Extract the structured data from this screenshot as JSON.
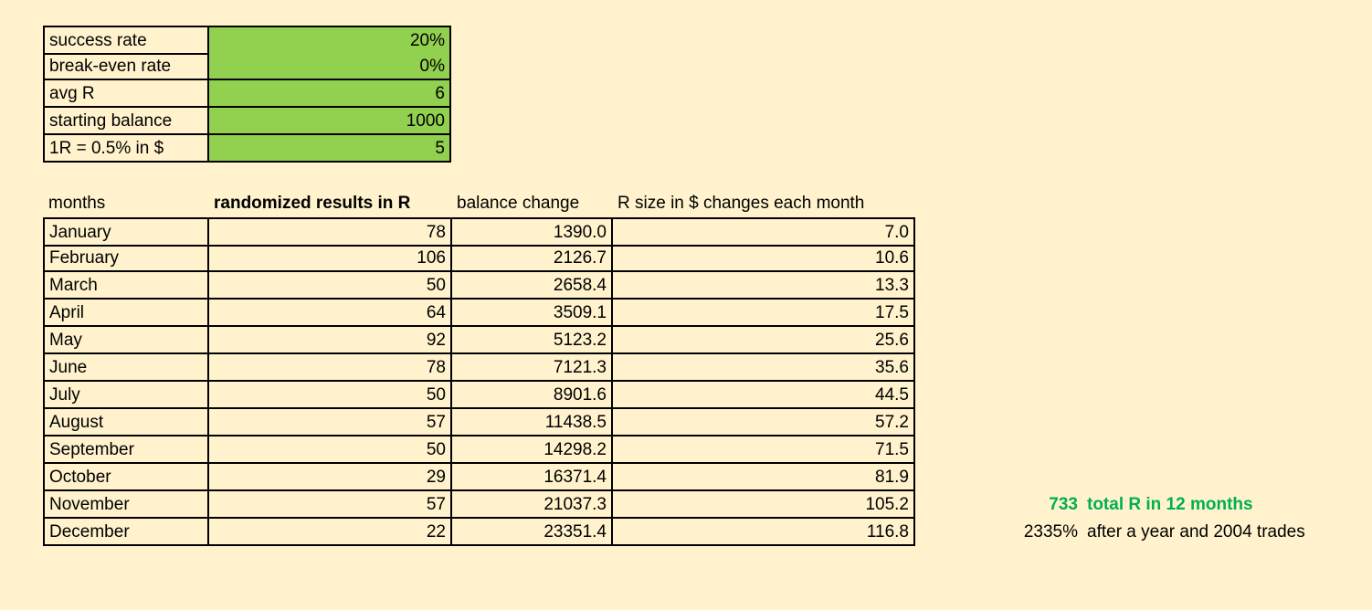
{
  "params": [
    {
      "label": "success rate",
      "value": "20%"
    },
    {
      "label": "break-even rate",
      "value": "0%"
    },
    {
      "label": "avg R",
      "value": "6"
    },
    {
      "label": "starting balance",
      "value": "1000"
    },
    {
      "label": "1R = 0.5% in $",
      "value": "5"
    }
  ],
  "table": {
    "headers": [
      "months",
      "randomized results in R",
      "balance change",
      "R size in $ changes each month"
    ],
    "rows": [
      {
        "month": "January",
        "r": "78",
        "balance": "1390.0",
        "rsize": "7.0"
      },
      {
        "month": "February",
        "r": "106",
        "balance": "2126.7",
        "rsize": "10.6"
      },
      {
        "month": "March",
        "r": "50",
        "balance": "2658.4",
        "rsize": "13.3"
      },
      {
        "month": "April",
        "r": "64",
        "balance": "3509.1",
        "rsize": "17.5"
      },
      {
        "month": "May",
        "r": "92",
        "balance": "5123.2",
        "rsize": "25.6"
      },
      {
        "month": "June",
        "r": "78",
        "balance": "7121.3",
        "rsize": "35.6"
      },
      {
        "month": "July",
        "r": "50",
        "balance": "8901.6",
        "rsize": "44.5"
      },
      {
        "month": "August",
        "r": "57",
        "balance": "11438.5",
        "rsize": "57.2"
      },
      {
        "month": "September",
        "r": "50",
        "balance": "14298.2",
        "rsize": "71.5"
      },
      {
        "month": "October",
        "r": "29",
        "balance": "16371.4",
        "rsize": "81.9"
      },
      {
        "month": "November",
        "r": "57",
        "balance": "21037.3",
        "rsize": "105.2"
      },
      {
        "month": "December",
        "r": "22",
        "balance": "23351.4",
        "rsize": "116.8"
      }
    ]
  },
  "summary": {
    "total_r_value": "733",
    "total_r_label": "total R in 12 months",
    "growth_value": "2335%",
    "growth_label": "after a year and 2004 trades"
  },
  "colors": {
    "background": "#fff2cc",
    "input_fill": "#92d050",
    "highlight_text": "#00b050"
  }
}
